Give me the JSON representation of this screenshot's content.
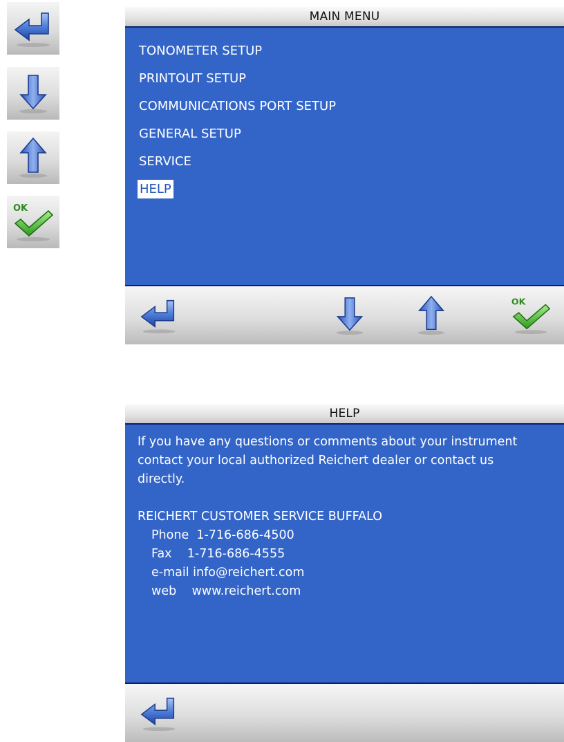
{
  "main_menu": {
    "title": "MAIN MENU",
    "items": [
      {
        "label": "TONOMETER SETUP"
      },
      {
        "label": "PRINTOUT SETUP"
      },
      {
        "label": "COMMUNICATIONS PORT SETUP"
      },
      {
        "label": "GENERAL SETUP"
      },
      {
        "label": "SERVICE"
      },
      {
        "label": "HELP",
        "selected": true
      }
    ]
  },
  "help_screen": {
    "title": "HELP",
    "intro_lines": [
      "If you have any questions or comments about your instrument",
      "contact your local authorized Reichert dealer or contact us",
      "directly."
    ],
    "company": "REICHERT CUSTOMER SERVICE BUFFALO",
    "phone": "Phone  1-716-686-4500",
    "fax": "Fax    1-716-686-4555",
    "email": "e-mail info@reichert.com",
    "web": "web    www.reichert.com"
  },
  "icons": {
    "back": "back-arrow-icon",
    "down": "down-arrow-icon",
    "up": "up-arrow-icon",
    "ok": "ok-check-icon",
    "ok_text": "OK"
  },
  "colors": {
    "screen_blue": "#3365c9",
    "arrow_blue": "#2f5fc4",
    "check_green": "#3fae2a"
  }
}
